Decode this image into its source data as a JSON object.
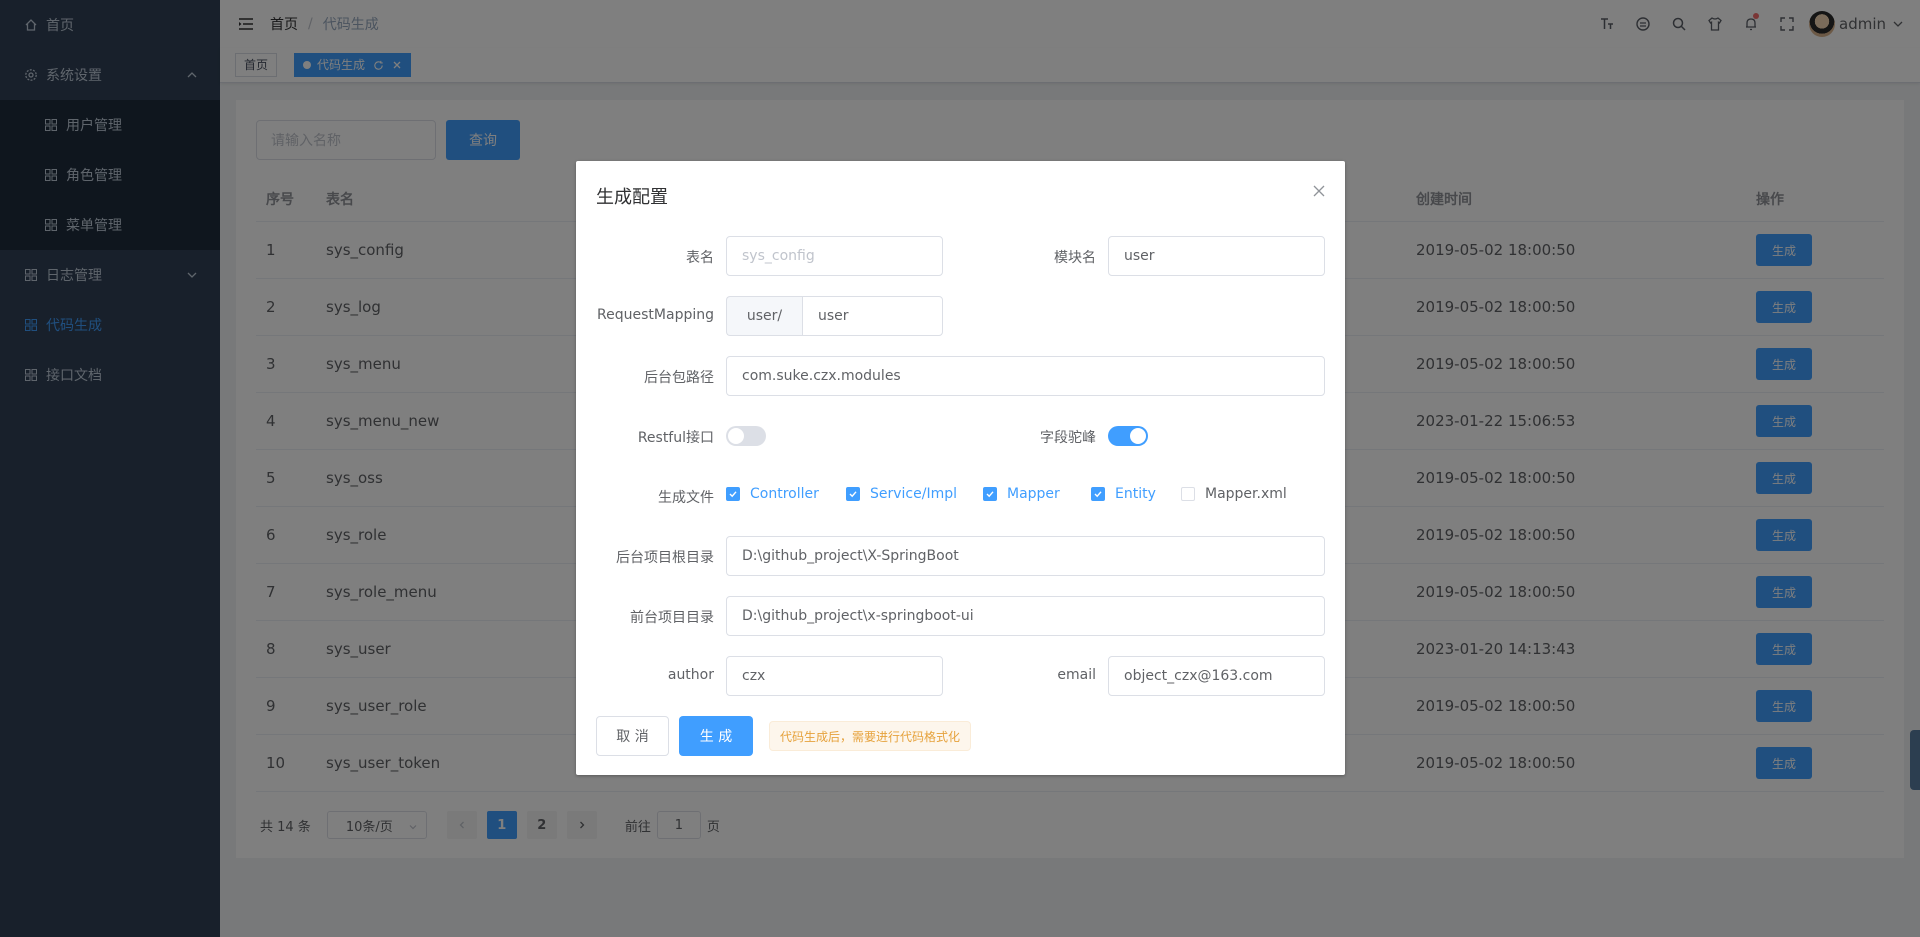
{
  "sidebar": {
    "home": "首页",
    "system_settings": "系统设置",
    "user_management": "用户管理",
    "role_management": "角色管理",
    "menu_management": "菜单管理",
    "log_management": "日志管理",
    "code_generation": "代码生成",
    "api_docs": "接口文档"
  },
  "navbar": {
    "breadcrumb_home": "首页",
    "breadcrumb_sep": "/",
    "breadcrumb_current": "代码生成",
    "username": "admin"
  },
  "tags": {
    "home": "首页",
    "current": "代码生成"
  },
  "search": {
    "placeholder": "请输入名称",
    "button": "查询"
  },
  "table": {
    "headers": {
      "no": "序号",
      "name": "表名",
      "created": "创建时间",
      "op": "操作"
    },
    "rows": [
      {
        "no": "1",
        "name": "sys_config",
        "created": "2019-05-02 18:00:50",
        "op": "生成"
      },
      {
        "no": "2",
        "name": "sys_log",
        "created": "2019-05-02 18:00:50",
        "op": "生成"
      },
      {
        "no": "3",
        "name": "sys_menu",
        "created": "2019-05-02 18:00:50",
        "op": "生成"
      },
      {
        "no": "4",
        "name": "sys_menu_new",
        "created": "2023-01-22 15:06:53",
        "op": "生成"
      },
      {
        "no": "5",
        "name": "sys_oss",
        "created": "2019-05-02 18:00:50",
        "op": "生成"
      },
      {
        "no": "6",
        "name": "sys_role",
        "created": "2019-05-02 18:00:50",
        "op": "生成"
      },
      {
        "no": "7",
        "name": "sys_role_menu",
        "created": "2019-05-02 18:00:50",
        "op": "生成"
      },
      {
        "no": "8",
        "name": "sys_user",
        "created": "2023-01-20 14:13:43",
        "op": "生成"
      },
      {
        "no": "9",
        "name": "sys_user_role",
        "created": "2019-05-02 18:00:50",
        "op": "生成"
      },
      {
        "no": "10",
        "name": "sys_user_token",
        "created": "2019-05-02 18:00:50",
        "op": "生成"
      }
    ]
  },
  "pagination": {
    "total": "共 14 条",
    "page_size": "10条/页",
    "page1": "1",
    "page2": "2",
    "goto_prefix": "前往",
    "goto_value": "1",
    "goto_suffix": "页"
  },
  "dialog": {
    "title": "生成配置",
    "table_name_label": "表名",
    "table_name_value": "sys_config",
    "module_label": "模块名",
    "module_value": "user",
    "request_mapping_label": "RequestMapping",
    "request_mapping_prefix": "user/",
    "request_mapping_value": "user",
    "package_label": "后台包路径",
    "package_value": "com.suke.czx.modules",
    "restful_label": "Restful接口",
    "camel_label": "字段驼峰",
    "files_label": "生成文件",
    "files": {
      "controller": "Controller",
      "service": "Service/Impl",
      "mapper": "Mapper",
      "entity": "Entity",
      "mapper_xml": "Mapper.xml"
    },
    "backend_root_label": "后台项目根目录",
    "backend_root_value": "D:\\github_project\\X-SpringBoot",
    "frontend_root_label": "前台项目目录",
    "frontend_root_value": "D:\\github_project\\x-springboot-ui",
    "author_label": "author",
    "author_value": "czx",
    "email_label": "email",
    "email_value": "object_czx@163.com",
    "cancel_button": "取 消",
    "generate_button": "生 成",
    "tip": "代码生成后，需要进行代码格式化"
  },
  "colors": {
    "primary": "#409eff",
    "sidebar_bg": "#304156",
    "warning": "#e6a23c"
  },
  "icons": [
    "home-icon",
    "gear-icon",
    "grid-icon",
    "chevron-up-icon",
    "chevron-down-icon",
    "hamburger-icon",
    "font-size-icon",
    "github-icon",
    "search-icon",
    "shirt-icon",
    "bell-icon",
    "fullscreen-icon",
    "refresh-icon",
    "close-icon"
  ]
}
